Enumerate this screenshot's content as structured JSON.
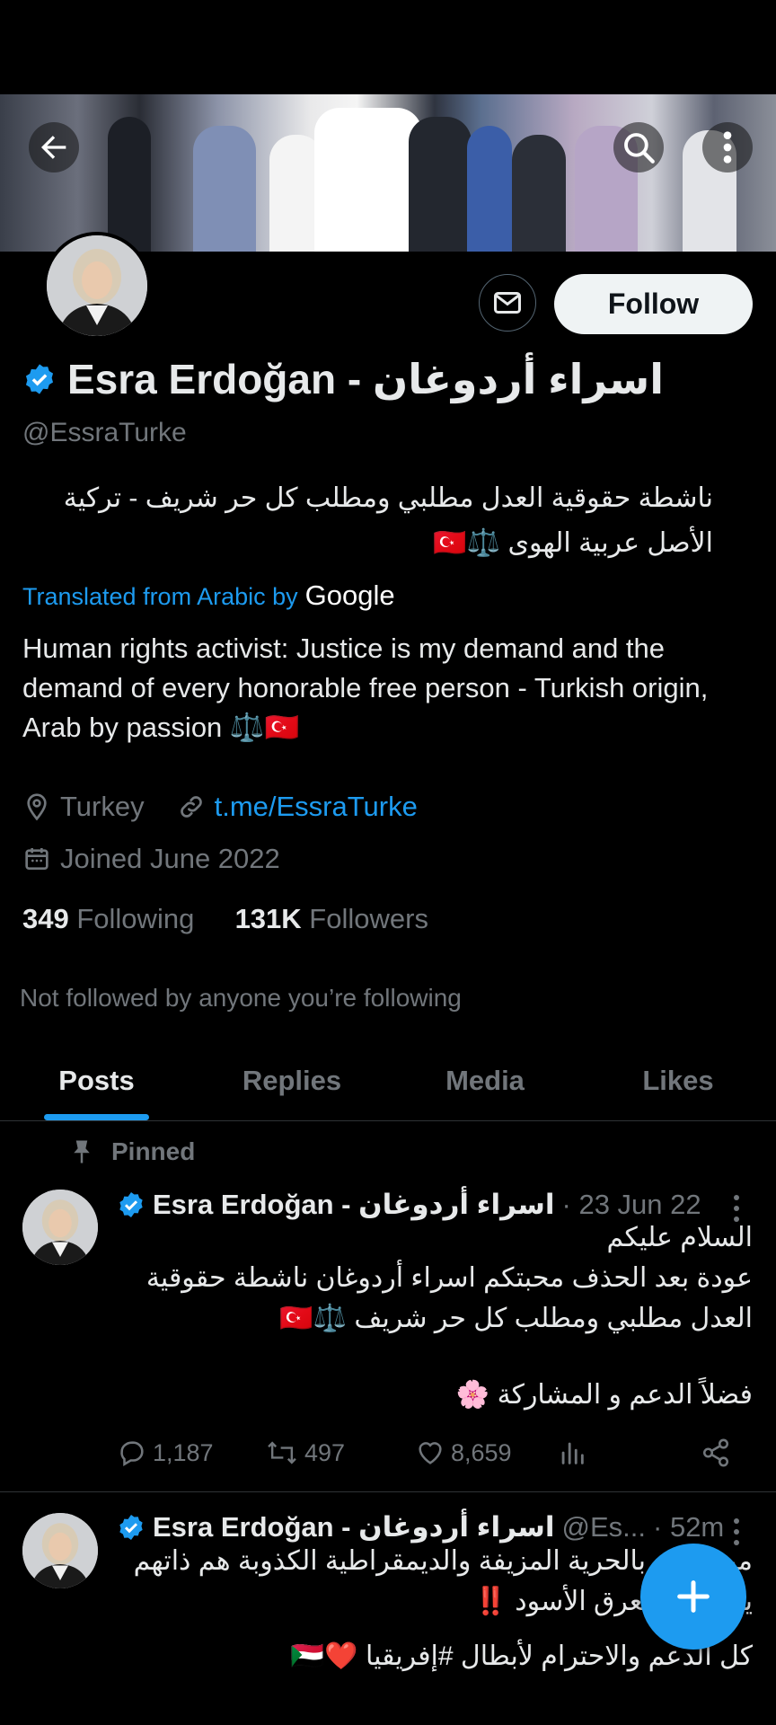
{
  "profile": {
    "display_name": "Esra Erdoğan - اسراء أردوغان",
    "handle": "@EssraTurke",
    "bio_original": "ناشطة حقوقية العدل مطلبي ومطلب كل حر شريف - تركية الأصل عربية الهوى ⚖️🇹🇷",
    "translated_label": "Translated from Arabic by",
    "translated_brand": "Google",
    "bio_translated": "Human rights activist: Justice is my demand and the demand of every honorable free person - Turkish origin, Arab by passion ⚖️🇹🇷",
    "location": "Turkey",
    "website": "t.me/EssraTurke",
    "joined": "Joined June 2022",
    "following_count": "349",
    "following_label": "Following",
    "followers_count": "131K",
    "followers_label": "Followers",
    "not_followed": "Not followed by anyone you’re following"
  },
  "header": {
    "follow_label": "Follow"
  },
  "tabs": [
    {
      "label": "Posts",
      "active": true
    },
    {
      "label": "Replies",
      "active": false
    },
    {
      "label": "Media",
      "active": false
    },
    {
      "label": "Likes",
      "active": false
    }
  ],
  "posts": [
    {
      "pinned_label": "Pinned",
      "name": "Esra Erdoğan - اسراء أردوغان",
      "meta": "· 23 Jun 22",
      "lines": [
        "السلام عليكم",
        "عودة بعد الحذف محبتكم اسراء أردوغان ناشطة حقوقية",
        "العدل مطلبي ومطلب كل حر شريف ⚖️🇹🇷",
        "",
        "فضلاً الدعم و المشاركة 🌸"
      ],
      "replies": "1,187",
      "reposts": "497",
      "likes": "8,659"
    },
    {
      "name": "Esra Erdoğan - اسراء أردوغان",
      "handle_short": "@Es...",
      "meta": "· 52m",
      "lines": [
        "من ينادي بالحرية المزيفة والديمقراطية الكذوبة هم ذاتهم",
        "يدعمون العرق الأسود ‼️",
        "",
        "كل الدعم والاحترام لأبطال #إفريقيا ❤️🇸🇩"
      ]
    }
  ],
  "icons": {
    "back": "arrow-left-icon",
    "search": "search-icon",
    "more": "more-vertical-icon",
    "message": "envelope-icon",
    "verified": "verified-badge-icon",
    "location": "location-pin-icon",
    "link": "link-icon",
    "calendar": "calendar-icon",
    "pin": "pin-icon",
    "reply": "comment-icon",
    "repost": "repost-icon",
    "like": "heart-icon",
    "views": "analytics-icon",
    "share": "share-icon",
    "compose": "plus-icon"
  },
  "colors": {
    "accent": "#1d9bf0",
    "muted": "#71767b",
    "background": "#000000",
    "text": "#e7e9ea"
  }
}
